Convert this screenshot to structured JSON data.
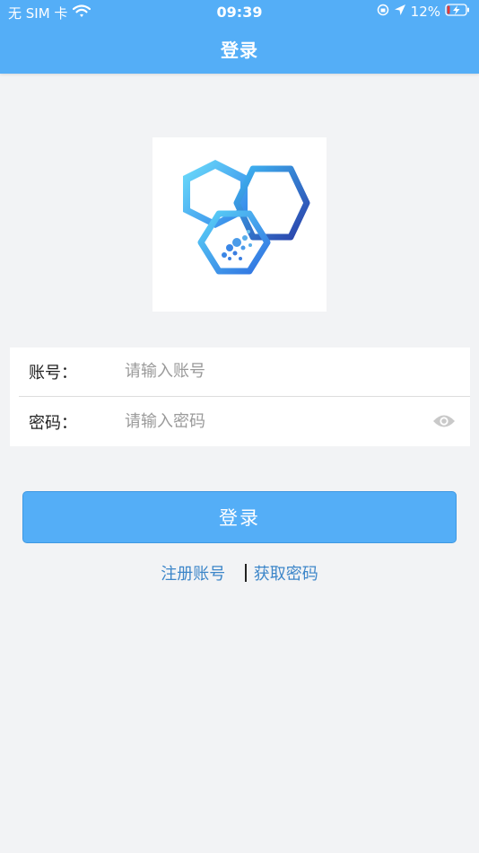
{
  "status": {
    "carrier": "无 SIM 卡",
    "time": "09:39",
    "battery": "12%"
  },
  "nav": {
    "title": "登录"
  },
  "form": {
    "account": {
      "label": "账号：",
      "placeholder": "请输入账号"
    },
    "password": {
      "label": "密码：",
      "placeholder": "请输入密码"
    }
  },
  "login_button": "登录",
  "links": {
    "register": "注册账号",
    "retrieve": "获取密码"
  },
  "colors": {
    "primary": "#54aef7",
    "link": "#3d86c9",
    "background": "#f2f3f5"
  },
  "icons": [
    "wifi-icon",
    "orientation-lock-icon",
    "location-arrow-icon",
    "battery-charging-icon",
    "app-logo-icon",
    "eye-icon"
  ]
}
